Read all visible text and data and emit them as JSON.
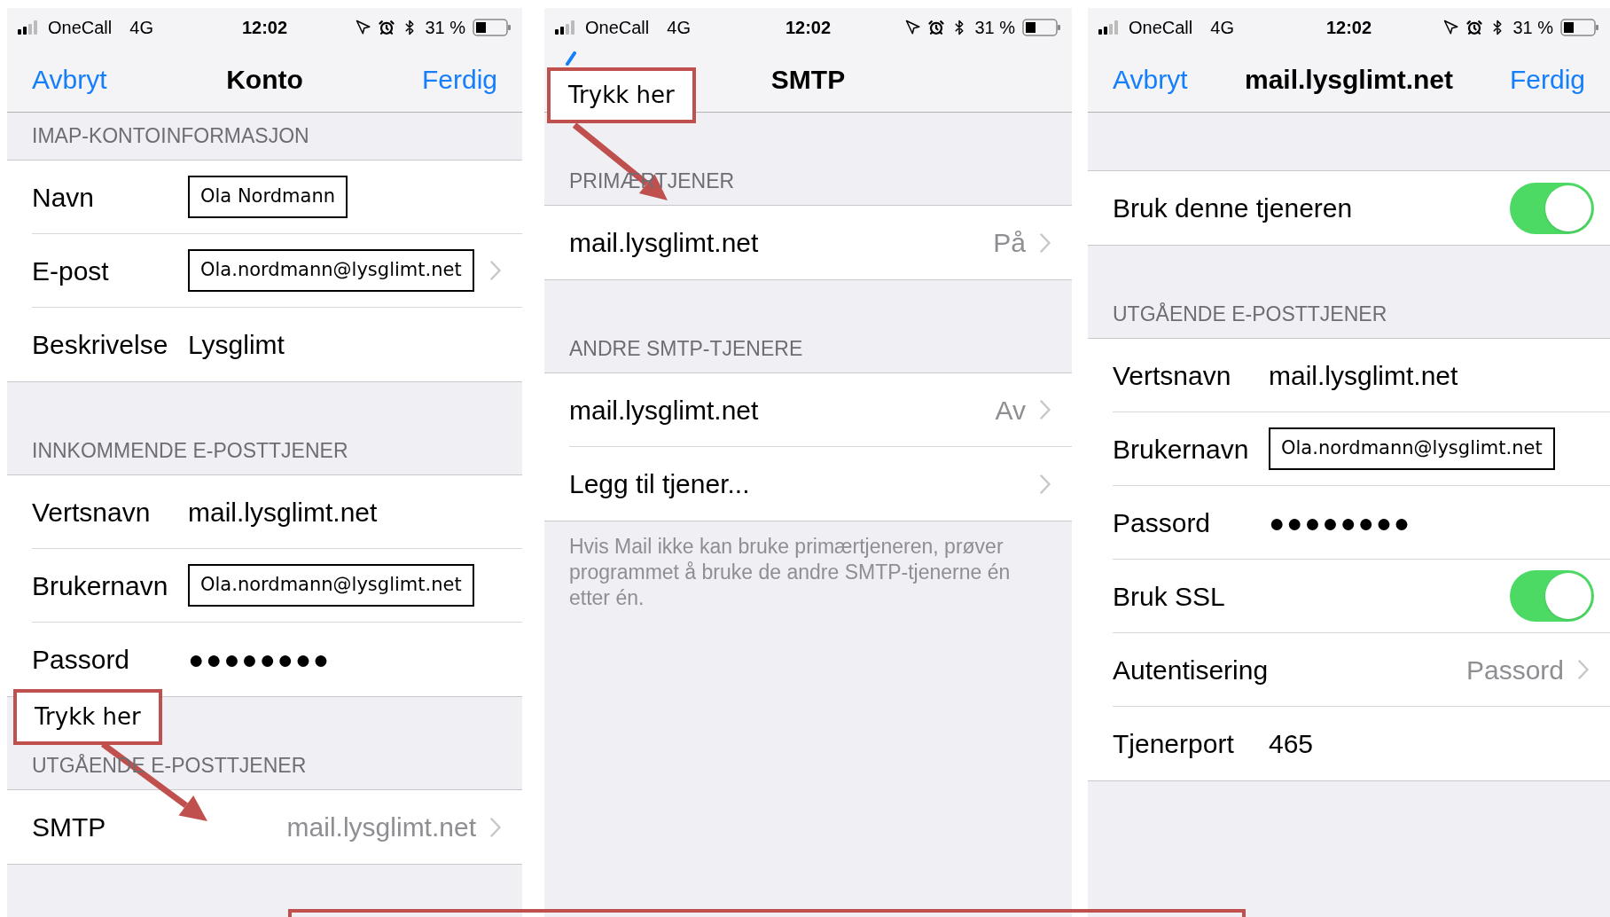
{
  "panels": [
    {
      "status_bar": {
        "carrier": "OneCall",
        "network": "4G",
        "time": "12:02",
        "battery": "31 %"
      },
      "nav": {
        "left": "Avbryt",
        "title": "Konto",
        "right": "Ferdig"
      },
      "sections": [
        {
          "header": "IMAP-KONTOINFORMASJON",
          "rows": [
            {
              "kind": "boxed",
              "label": "Navn",
              "value": "Ola Nordmann",
              "disclosure": false
            },
            {
              "kind": "boxed",
              "label": "E-post",
              "value": "Ola.nordmann@lysglimt.net",
              "disclosure": true
            },
            {
              "kind": "text",
              "label": "Beskrivelse",
              "value": "Lysglimt",
              "disclosure": false
            }
          ]
        },
        {
          "header": "INNKOMMENDE E-POSTTJENER",
          "rows": [
            {
              "kind": "text",
              "label": "Vertsnavn",
              "value": "mail.lysglimt.net",
              "disclosure": false
            },
            {
              "kind": "boxed",
              "label": "Brukernavn",
              "value": "Ola.nordmann@lysglimt.net",
              "disclosure": false
            },
            {
              "kind": "secret",
              "label": "Passord",
              "value": "●●●●●●●●",
              "disclosure": false
            }
          ]
        },
        {
          "header": "UTGÅENDE E-POSTTJENER",
          "rows": [
            {
              "kind": "link",
              "label": "SMTP",
              "detail": "mail.lysglimt.net",
              "disclosure": true
            }
          ]
        }
      ],
      "callout": {
        "text": "Trykk her"
      }
    },
    {
      "status_bar": {
        "carrier": "OneCall",
        "network": "4G",
        "time": "12:02",
        "battery": "31 %"
      },
      "nav": {
        "title": "SMTP"
      },
      "sections": [
        {
          "header": "PRIMÆRTJENER",
          "rows": [
            {
              "kind": "link",
              "label": "mail.lysglimt.net",
              "detail": "På",
              "disclosure": true
            }
          ]
        },
        {
          "header": "ANDRE SMTP-TJENERE",
          "rows": [
            {
              "kind": "link",
              "label": "mail.lysglimt.net",
              "detail": "Av",
              "disclosure": true
            },
            {
              "kind": "link",
              "label": "Legg til tjener...",
              "disclosure": true
            }
          ]
        }
      ],
      "footer": "Hvis Mail ikke kan bruke primærtjeneren, prøver programmet å bruke de andre SMTP-tjenerne én etter én.",
      "callout": {
        "text": "Trykk her"
      }
    },
    {
      "status_bar": {
        "carrier": "OneCall",
        "network": "4G",
        "time": "12:02",
        "battery": "31 %"
      },
      "nav": {
        "left": "Avbryt",
        "title": "mail.lysglimt.net",
        "right": "Ferdig"
      },
      "sections": [
        {
          "rows": [
            {
              "kind": "toggle",
              "label": "Bruk denne tjeneren",
              "on": true,
              "disclosure": false
            }
          ]
        },
        {
          "header": "UTGÅENDE E-POSTTJENER",
          "rows": [
            {
              "kind": "text",
              "label": "Vertsnavn",
              "value": "mail.lysglimt.net",
              "disclosure": false
            },
            {
              "kind": "boxed",
              "label": "Brukernavn",
              "value": "Ola.nordmann@lysglimt.net",
              "disclosure": false
            },
            {
              "kind": "secret",
              "label": "Passord",
              "value": "●●●●●●●●",
              "disclosure": false
            },
            {
              "kind": "toggle",
              "label": "Bruk SSL",
              "on": true,
              "disclosure": false
            },
            {
              "kind": "link",
              "label": "Autentisering",
              "detail": "Passord",
              "disclosure": true
            },
            {
              "kind": "text",
              "label": "Tjenerport",
              "value": "465",
              "disclosure": false
            }
          ]
        }
      ]
    }
  ]
}
